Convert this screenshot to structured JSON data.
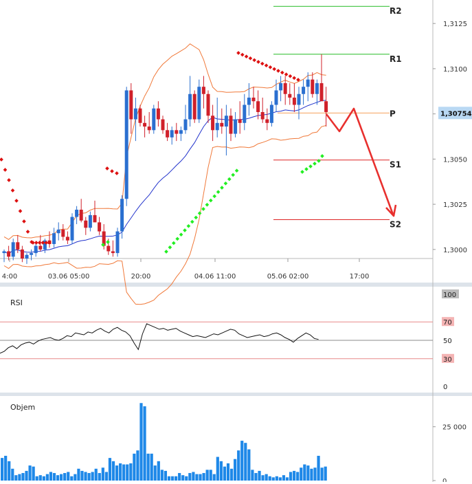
{
  "chart_data": [
    {
      "type": "candlestick",
      "panel": "price",
      "x_tick_labels": [
        "4:00",
        "03.06 05:00",
        "20:00",
        "04.06 11:00",
        "05.06 02:00",
        "17:00"
      ],
      "y_tick_labels": [
        "1,3125",
        "1,3100",
        "1,3075",
        "1,3050",
        "1,3025",
        "1,3000"
      ],
      "ylim": [
        1.2995,
        1.3138
      ],
      "current_price_label": "1,30754",
      "pivot_levels": [
        {
          "label": "R2",
          "value": 1.31345,
          "color": "#22bb22"
        },
        {
          "label": "R1",
          "value": 1.3108,
          "color": "#22bb22"
        },
        {
          "label": "P",
          "value": 1.30755,
          "color": "#f5a05a"
        },
        {
          "label": "S1",
          "value": 1.30495,
          "color": "#dd2222"
        },
        {
          "label": "S2",
          "value": 1.30165,
          "color": "#dd2222"
        }
      ],
      "projection_path": [
        [
          90,
          1.3075
        ],
        [
          93,
          1.3063
        ],
        [
          96,
          1.3078
        ],
        [
          101,
          1.302
        ]
      ],
      "candles": [
        [
          1.2998,
          1.3,
          1.2993,
          1.2999
        ],
        [
          1.2999,
          1.3002,
          1.2994,
          1.2996
        ],
        [
          1.2996,
          1.3006,
          1.2994,
          1.3004
        ],
        [
          1.3004,
          1.3008,
          1.2998,
          1.3
        ],
        [
          1.3,
          1.3002,
          1.2993,
          1.2995
        ],
        [
          1.2995,
          1.2998,
          1.2992,
          1.2997
        ],
        [
          1.2997,
          1.3,
          1.2994,
          1.2998
        ],
        [
          1.2998,
          1.3004,
          1.2996,
          1.3002
        ],
        [
          1.3002,
          1.3008,
          1.2999,
          1.3
        ],
        [
          1.3,
          1.3006,
          1.2998,
          1.3005
        ],
        [
          1.3005,
          1.301,
          1.3001,
          1.3003
        ],
        [
          1.3003,
          1.3012,
          1.3001,
          1.3009
        ],
        [
          1.3009,
          1.3015,
          1.3005,
          1.3011
        ],
        [
          1.3011,
          1.3014,
          1.3005,
          1.3007
        ],
        [
          1.3007,
          1.301,
          1.3003,
          1.3005
        ],
        [
          1.3005,
          1.302,
          1.3003,
          1.3018
        ],
        [
          1.3018,
          1.3024,
          1.3014,
          1.3022
        ],
        [
          1.3022,
          1.3028,
          1.3015,
          1.3016
        ],
        [
          1.3016,
          1.3018,
          1.3008,
          1.3012
        ],
        [
          1.3012,
          1.3021,
          1.301,
          1.3019
        ],
        [
          1.3019,
          1.3027,
          1.3016,
          1.3015
        ],
        [
          1.3015,
          1.3018,
          1.3008,
          1.301
        ],
        [
          1.301,
          1.3014,
          1.3,
          1.3002
        ],
        [
          1.3002,
          1.3006,
          1.2997,
          1.2999
        ],
        [
          1.2999,
          1.3005,
          1.2996,
          1.2998
        ],
        [
          1.2998,
          1.3012,
          1.2996,
          1.301
        ],
        [
          1.301,
          1.303,
          1.3006,
          1.3028
        ],
        [
          1.3028,
          1.309,
          1.3024,
          1.3088
        ],
        [
          1.3088,
          1.3092,
          1.3064,
          1.3072
        ],
        [
          1.3072,
          1.3084,
          1.306,
          1.3078
        ],
        [
          1.3078,
          1.308,
          1.3068,
          1.307
        ],
        [
          1.307,
          1.3074,
          1.3062,
          1.3068
        ],
        [
          1.3068,
          1.3076,
          1.3064,
          1.3066
        ],
        [
          1.3066,
          1.308,
          1.3064,
          1.3078
        ],
        [
          1.3078,
          1.3082,
          1.3068,
          1.3072
        ],
        [
          1.3072,
          1.3074,
          1.3064,
          1.3066
        ],
        [
          1.3066,
          1.307,
          1.306,
          1.3062
        ],
        [
          1.3062,
          1.3068,
          1.3058,
          1.3066
        ],
        [
          1.3066,
          1.307,
          1.306,
          1.3064
        ],
        [
          1.3064,
          1.3068,
          1.306,
          1.3066
        ],
        [
          1.3066,
          1.308,
          1.3064,
          1.3072
        ],
        [
          1.3072,
          1.3096,
          1.3068,
          1.3086
        ],
        [
          1.3086,
          1.3088,
          1.307,
          1.3072
        ],
        [
          1.3072,
          1.3094,
          1.307,
          1.309
        ],
        [
          1.309,
          1.3096,
          1.3078,
          1.3086
        ],
        [
          1.3086,
          1.3088,
          1.307,
          1.3074
        ],
        [
          1.3074,
          1.308,
          1.306,
          1.3066
        ],
        [
          1.3066,
          1.3084,
          1.3062,
          1.307
        ],
        [
          1.307,
          1.3078,
          1.3064,
          1.3068
        ],
        [
          1.3068,
          1.308,
          1.3052,
          1.3074
        ],
        [
          1.3074,
          1.3078,
          1.306,
          1.3064
        ],
        [
          1.3064,
          1.3076,
          1.3062,
          1.3072
        ],
        [
          1.3072,
          1.3082,
          1.3064,
          1.307
        ],
        [
          1.307,
          1.3086,
          1.3066,
          1.308
        ],
        [
          1.308,
          1.3092,
          1.3074,
          1.3084
        ],
        [
          1.3084,
          1.309,
          1.3078,
          1.3082
        ],
        [
          1.3082,
          1.3088,
          1.3072,
          1.3076
        ],
        [
          1.3076,
          1.3084,
          1.307,
          1.3072
        ],
        [
          1.3072,
          1.3078,
          1.3066,
          1.307
        ],
        [
          1.307,
          1.3082,
          1.3068,
          1.308
        ],
        [
          1.308,
          1.3094,
          1.3076,
          1.3088
        ],
        [
          1.3088,
          1.3096,
          1.3082,
          1.3092
        ],
        [
          1.3092,
          1.3096,
          1.308,
          1.3086
        ],
        [
          1.3086,
          1.3092,
          1.308,
          1.3084
        ],
        [
          1.3084,
          1.3092,
          1.3076,
          1.308
        ],
        [
          1.308,
          1.309,
          1.3072,
          1.3086
        ],
        [
          1.3086,
          1.3094,
          1.308,
          1.309
        ],
        [
          1.309,
          1.3098,
          1.3082,
          1.3094
        ],
        [
          1.3094,
          1.3098,
          1.3084,
          1.3086
        ],
        [
          1.3086,
          1.3094,
          1.308,
          1.3092
        ],
        [
          1.3092,
          1.3108,
          1.3086,
          1.3082
        ],
        [
          1.3082,
          1.309,
          1.3068,
          1.3076
        ]
      ]
    },
    {
      "type": "line",
      "panel": "rsi",
      "label": "RSI",
      "y_tick_labels": [
        "100",
        "70",
        "50",
        "30",
        "0"
      ],
      "ylim": [
        0,
        100
      ],
      "levels": [
        70,
        50,
        30
      ],
      "values": [
        36,
        38,
        42,
        44,
        41,
        45,
        47,
        48,
        46,
        49,
        51,
        52,
        53,
        51,
        50,
        52,
        55,
        54,
        58,
        57,
        56,
        59,
        58,
        61,
        63,
        60,
        58,
        62,
        64,
        61,
        59,
        55,
        47,
        40,
        57,
        68,
        66,
        64,
        62,
        63,
        61,
        62,
        63,
        60,
        58,
        56,
        54,
        55,
        54,
        53,
        55,
        57,
        56,
        58,
        60,
        62,
        61,
        57,
        55,
        53,
        54,
        55,
        56,
        54,
        55,
        57,
        58,
        56,
        53,
        51,
        48,
        52,
        55,
        58,
        56,
        52,
        51
      ]
    },
    {
      "type": "bar",
      "panel": "volume",
      "label": "Objem",
      "y_tick_labels": [
        "25 000",
        "0"
      ],
      "ylim": [
        0,
        38000
      ],
      "values": [
        10500,
        11500,
        9000,
        5500,
        2500,
        3000,
        3500,
        4500,
        7000,
        6500,
        2000,
        2500,
        2000,
        3000,
        4000,
        3500,
        2500,
        3000,
        3500,
        4000,
        2000,
        3000,
        5500,
        4500,
        4000,
        3500,
        4000,
        5500,
        3500,
        6000,
        4000,
        10500,
        9000,
        7000,
        8000,
        7500,
        7500,
        8000,
        12500,
        14000,
        36000,
        34500,
        12500,
        12500,
        7000,
        9000,
        5000,
        4500,
        2000,
        2000,
        2000,
        3500,
        2500,
        2000,
        3500,
        4000,
        3000,
        3000,
        3500,
        5000,
        5000,
        3000,
        11000,
        9000,
        6500,
        8000,
        5500,
        10000,
        14000,
        18500,
        17500,
        14500,
        5000,
        3500,
        4500,
        2500,
        3000,
        2000,
        1500,
        2000,
        1500,
        2500,
        1500,
        4000,
        4500,
        4000,
        6000,
        7500,
        7000,
        5500,
        6000,
        11500,
        6000,
        6500
      ]
    }
  ]
}
